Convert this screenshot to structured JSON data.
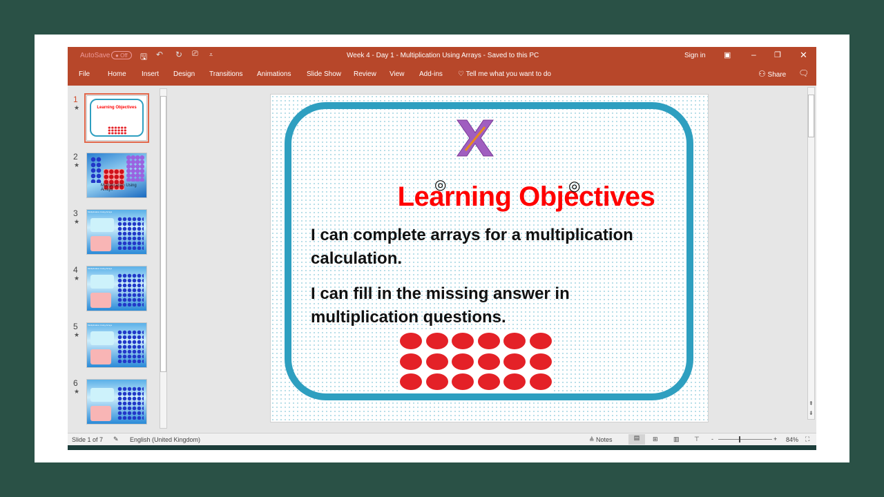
{
  "window": {
    "autosave": "AutoSave",
    "autosave_state": "Off",
    "title": "Week 4 - Day 1 - Multiplication Using Arrays  -  Saved to this PC",
    "sign_in": "Sign in",
    "accent": "#b7472a"
  },
  "ribbon": {
    "tabs": [
      "File",
      "Home",
      "Insert",
      "Design",
      "Transitions",
      "Animations",
      "Slide Show",
      "Review",
      "View",
      "Add-ins"
    ],
    "tell_me": "Tell me what you want to do",
    "share": "Share"
  },
  "thumbnails": [
    {
      "num": "1",
      "title": "Learning Objectives",
      "caption": ""
    },
    {
      "num": "2",
      "title": "",
      "caption": "Multiplication Using Arrays"
    },
    {
      "num": "3",
      "title": "Multiplication Using Arrays",
      "caption": ""
    },
    {
      "num": "4",
      "title": "Multiplication Using Arrays",
      "caption": ""
    },
    {
      "num": "5",
      "title": "Multiplication Using Arrays",
      "caption": ""
    },
    {
      "num": "6",
      "title": "",
      "caption": ""
    }
  ],
  "slide": {
    "logo": "X",
    "title": "Learning Objectives",
    "objectives": [
      "I can complete arrays for a multiplication calculation.",
      "I can fill in the missing answer in multiplication questions."
    ],
    "array_rows": 3,
    "array_cols": 6,
    "border_color": "#2e9fc0",
    "title_color": "#ff0000"
  },
  "status": {
    "slide_info": "Slide 1 of 7",
    "language": "English (United Kingdom)",
    "notes": "Notes",
    "zoom": "84%"
  }
}
